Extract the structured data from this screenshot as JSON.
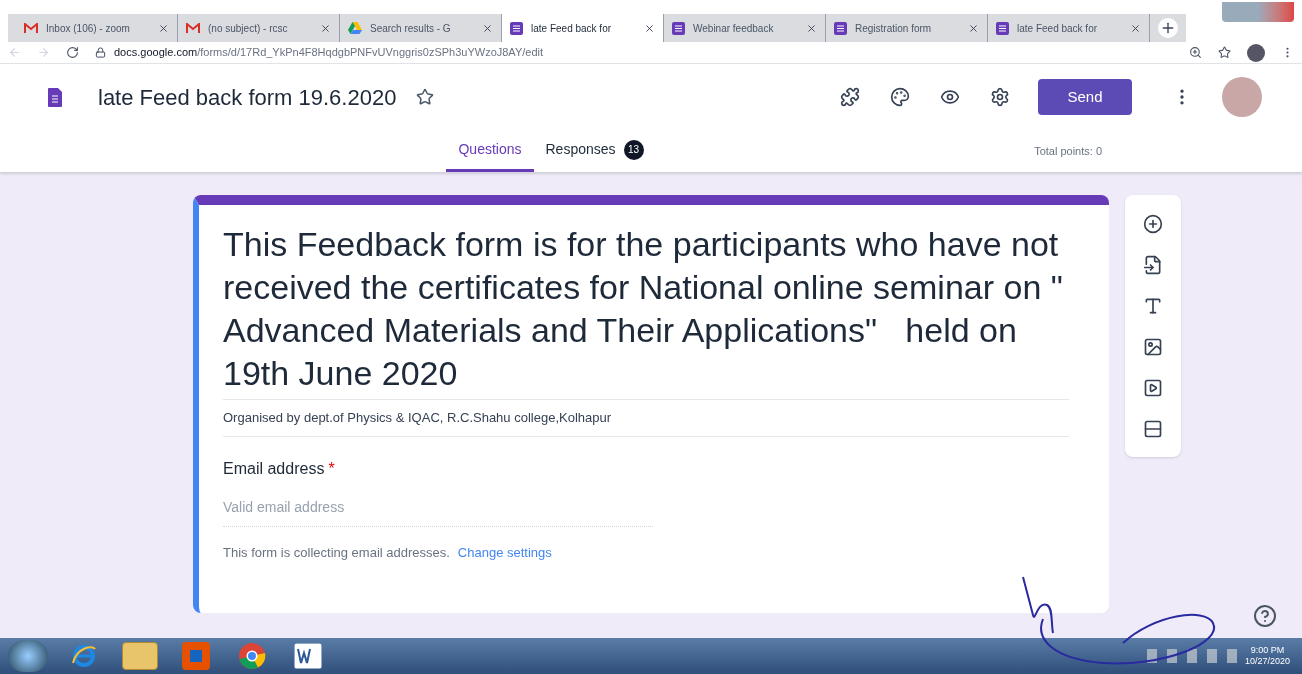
{
  "browser": {
    "tabs": [
      {
        "kind": "gmail",
        "label": "Inbox (106) - zoom",
        "selected": false
      },
      {
        "kind": "gmail",
        "label": "(no subject) - rcsc",
        "selected": false
      },
      {
        "kind": "drive",
        "label": "Search results - G",
        "selected": false
      },
      {
        "kind": "forms",
        "label": "late Feed back for",
        "selected": true
      },
      {
        "kind": "forms",
        "label": "Webinar feedback",
        "selected": false
      },
      {
        "kind": "forms",
        "label": "Registration form",
        "selected": false
      },
      {
        "kind": "forms",
        "label": "late Feed back for",
        "selected": false
      }
    ],
    "url_host": "docs.google.com",
    "url_path": "/forms/d/17Rd_YkPn4F8HqdgbPNFvUVnggris0zSPh3uYWzoJ8AY/edit"
  },
  "header": {
    "title": "late Feed back form 19.6.2020",
    "send": "Send"
  },
  "form_tabs": [
    {
      "label": "Questions",
      "selected": true
    },
    {
      "label": "Responses",
      "selected": false,
      "badge": "13"
    }
  ],
  "total_points": "Total points: 0",
  "form": {
    "title": "This Feedback form is for the participants who have not received the certificates for National online seminar on \" Advanced Materials and Their Applications\"   held on 19th June 2020",
    "description": "Organised by dept.of Physics & IQAC,  R.C.Shahu college,Kolhapur",
    "email_label": "Email address",
    "required_mark": "*",
    "email_placeholder": "Valid email address",
    "note": "This form is collecting email addresses.",
    "note_link": "Change settings"
  },
  "taskbar": {
    "apps": [
      {
        "kind": "ie"
      },
      {
        "kind": "explorer"
      },
      {
        "kind": "media"
      },
      {
        "kind": "chrome"
      },
      {
        "kind": "word"
      }
    ],
    "time": "9:00 PM",
    "date": "10/27/2020"
  }
}
